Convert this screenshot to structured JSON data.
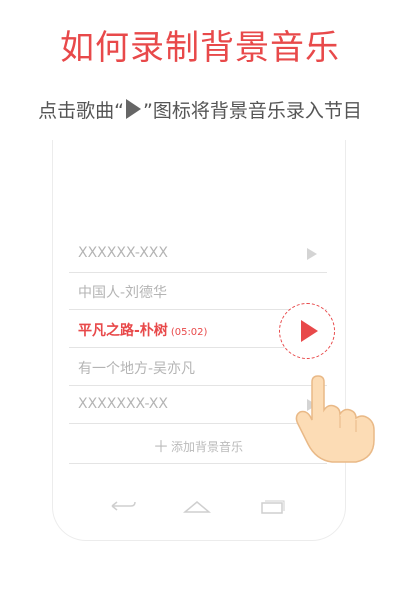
{
  "header": {
    "title": "如何录制背景音乐",
    "subtitle_before": "点击歌曲“",
    "subtitle_after": "”图标将背景音乐录入节目"
  },
  "song_list": [
    {
      "name": "XXXXXX-XXX",
      "duration": ""
    },
    {
      "name": "中国人-刘德华",
      "duration": ""
    },
    {
      "name": "平凡之路-朴树",
      "duration": "(05:02)",
      "active": true
    },
    {
      "name": "有一个地方-吴亦凡",
      "duration": ""
    },
    {
      "name": "XXXXXXX-XX",
      "duration": ""
    }
  ],
  "add_button": {
    "label": "添加背景音乐",
    "icon": "plus-icon"
  },
  "navbar": {
    "icons": [
      "back-icon",
      "home-icon",
      "recent-apps-icon"
    ]
  },
  "colors": {
    "accent": "#e8494a",
    "muted_text": "#b4b4b4",
    "play_icon": "#d4d4d4"
  }
}
